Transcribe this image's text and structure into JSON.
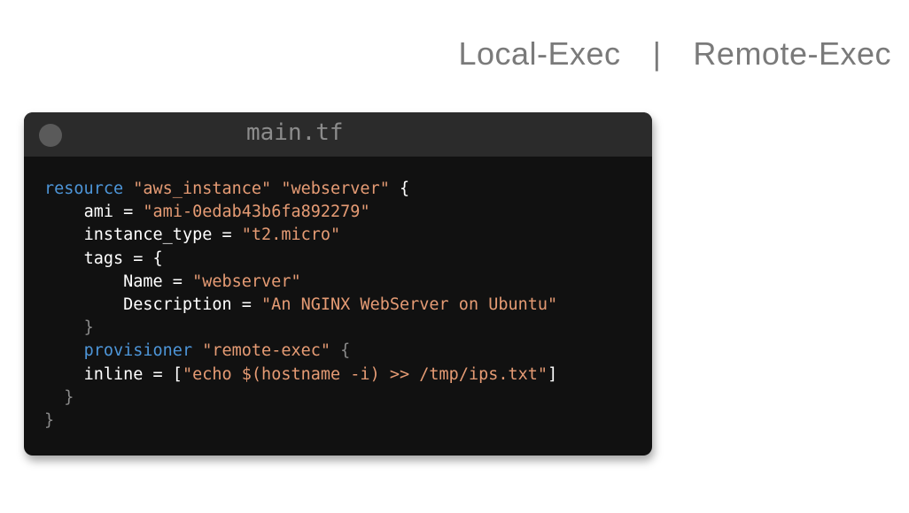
{
  "header": {
    "left_label": "Local-Exec",
    "separator": "|",
    "right_label": "Remote-Exec"
  },
  "editor": {
    "filename": "main.tf",
    "colors": {
      "keyword": "#4d95d8",
      "string": "#e59b74",
      "text": "#ffffff",
      "background": "#111111",
      "titlebar": "#2b2b2b"
    },
    "code": {
      "l1_kw": "resource",
      "l1_s1": "\"aws_instance\"",
      "l1_s2": "\"webserver\"",
      "l1_brace": "{",
      "l2_key": "ami =",
      "l2_val": "\"ami-0edab43b6fa892279\"",
      "l3_key": "instance_type =",
      "l3_val": "\"t2.micro\"",
      "l4_key": "tags = {",
      "l5_key": "Name =",
      "l5_val": "\"webserver\"",
      "l6_key": "Description =",
      "l6_val": "\"An NGINX WebServer on Ubuntu\"",
      "l7": "}",
      "l8_kw": "provisioner",
      "l8_val": "\"remote-exec\"",
      "l8_brace": "{",
      "l9_key": "inline = [",
      "l9_val": "\"echo $(hostname -i) >> /tmp/ips.txt\"",
      "l9_end": "]",
      "l10": "}",
      "l11": "}"
    }
  }
}
